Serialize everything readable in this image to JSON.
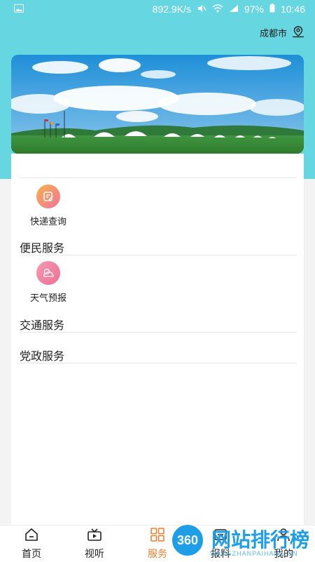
{
  "status_bar": {
    "speed": "892.9K/s",
    "battery": "97%",
    "time": "10:46"
  },
  "location": {
    "city": "成都市"
  },
  "services": {
    "express": {
      "label": "快递查询"
    },
    "sections": {
      "convenience": "便民服务",
      "traffic": "交通服务",
      "party": "党政服务"
    },
    "weather": {
      "label": "天气预报"
    }
  },
  "nav": {
    "items": [
      {
        "label": "首页",
        "icon": "home-icon"
      },
      {
        "label": "视听",
        "icon": "video-icon"
      },
      {
        "label": "服务",
        "icon": "grid-icon",
        "active": true
      },
      {
        "label": "报料",
        "icon": "report-icon"
      },
      {
        "label": "我的",
        "icon": "user-icon"
      }
    ]
  },
  "colors": {
    "accent_active": "#ef7f2f",
    "header_teal": "#66d6e1"
  },
  "watermark": {
    "badge": "360",
    "text": "网站排行榜",
    "sub": "WANGZHANPAIHANG.CN"
  }
}
